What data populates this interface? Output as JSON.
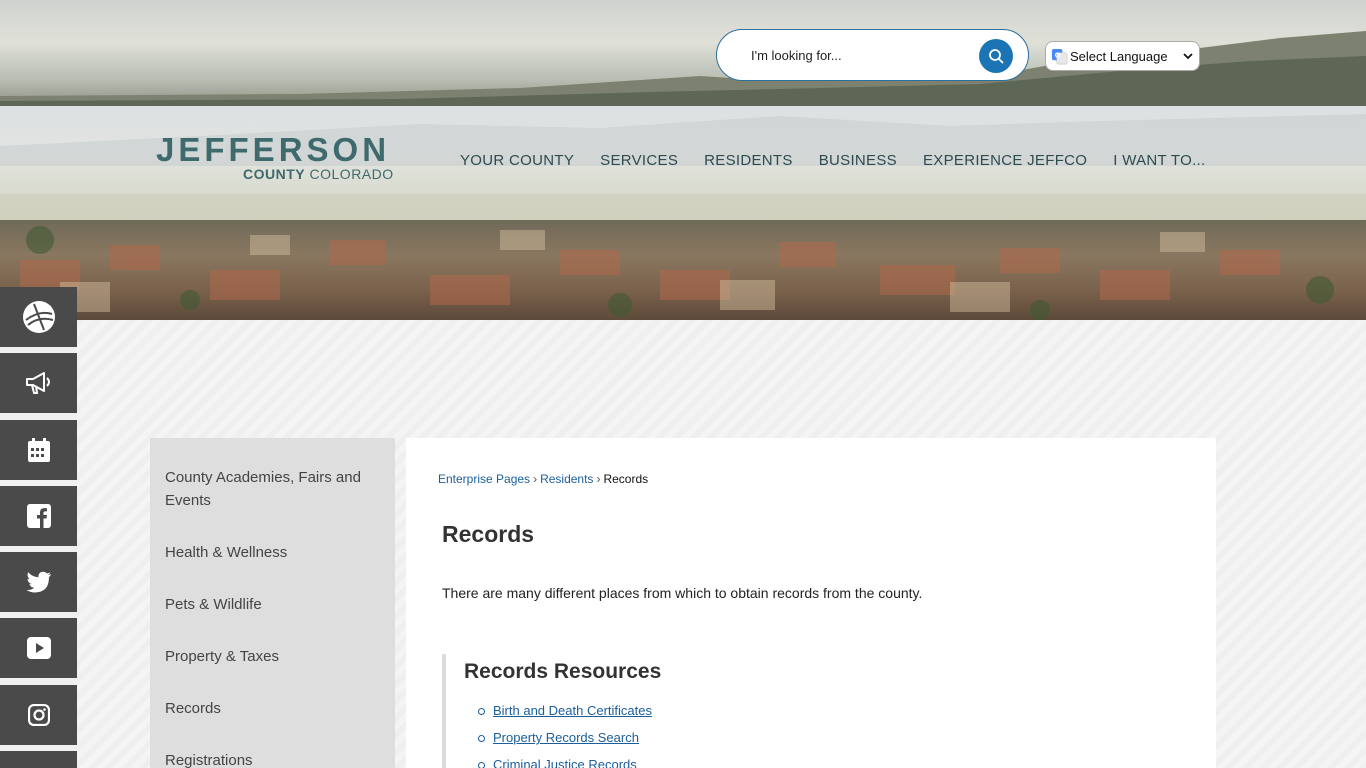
{
  "search": {
    "placeholder": "I'm looking for..."
  },
  "language": {
    "selected": "Select Language"
  },
  "logo": {
    "main": "JEFFERSON",
    "sub_bold": "COUNTY",
    "sub_rest": "COLORADO"
  },
  "nav": {
    "items": [
      "YOUR COUNTY",
      "SERVICES",
      "RESIDENTS",
      "BUSINESS",
      "EXPERIENCE JEFFCO",
      "I WANT TO..."
    ]
  },
  "rail": {
    "items": [
      "globe-icon",
      "megaphone-icon",
      "calendar-icon",
      "facebook-icon",
      "twitter-icon",
      "youtube-icon",
      "instagram-icon"
    ]
  },
  "sidebar": {
    "items": [
      "County Academies, Fairs and Events",
      "Health & Wellness",
      "Pets & Wildlife",
      "Property & Taxes",
      "Records",
      "Registrations"
    ]
  },
  "breadcrumb": {
    "items": [
      "Enterprise Pages",
      "Residents",
      "Records"
    ]
  },
  "page": {
    "title": "Records",
    "intro": "There are many different places from which to obtain records from the county."
  },
  "resources": {
    "title": "Records Resources",
    "links": [
      "Birth and Death Certificates",
      "Property Records Search",
      "Criminal Justice Records"
    ]
  },
  "colors": {
    "accent": "#1b75b4",
    "link": "#1b5e9c",
    "logo": "#3f6a6d",
    "rail": "#4a4a4a"
  }
}
